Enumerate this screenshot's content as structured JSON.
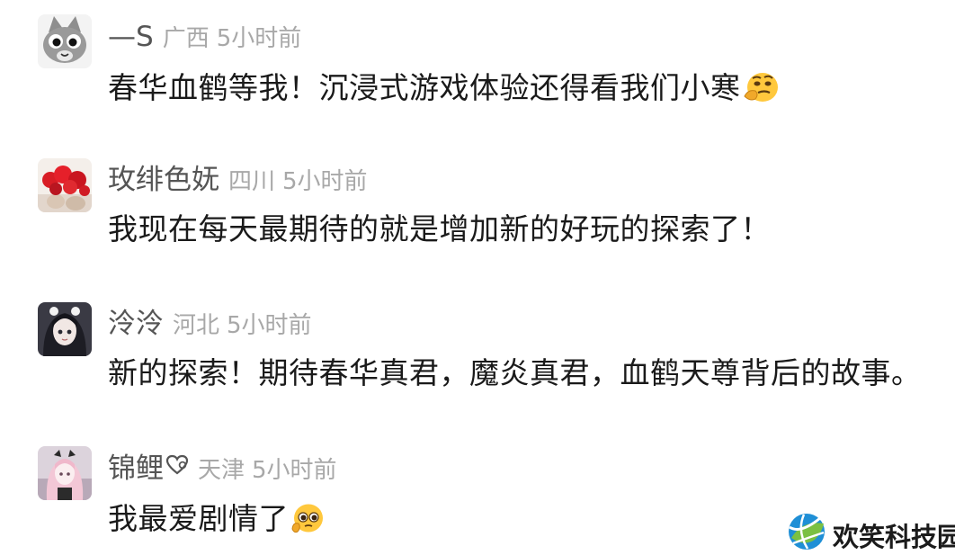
{
  "comments": [
    {
      "username": "—S",
      "region": "广西",
      "time": "5小时前",
      "text": "春华血鹤等我！沉浸式游戏体验还得看我们小寒",
      "emoji": "thinking-face-emoji",
      "avatar": "cartoon-cat-avatar"
    },
    {
      "username": "玫绯色妩",
      "region": "四川",
      "time": "5小时前",
      "text": "我现在每天最期待的就是增加新的好玩的探索了！",
      "avatar": "red-flowers-avatar"
    },
    {
      "username": "泠泠",
      "region": "河北",
      "time": "5小时前",
      "text": "新的探索！期待春华真君，魔炎真君，血鹤天尊背后的故事。",
      "avatar": "anime-girl-avatar"
    },
    {
      "username": "锦鲤",
      "username_icon": "heart-sparkle-icon",
      "region": "天津",
      "time": "5小时前",
      "text": "我最爱剧情了",
      "emoji": "pleading-face-emoji",
      "avatar": "pink-hair-girl-avatar"
    }
  ],
  "watermark": {
    "text": "欢笑科技园",
    "logo": "globe-logo-icon"
  },
  "colors": {
    "username": "#555555",
    "meta": "#a8a8a8",
    "text": "#1a1a1a",
    "background": "#ffffff"
  }
}
